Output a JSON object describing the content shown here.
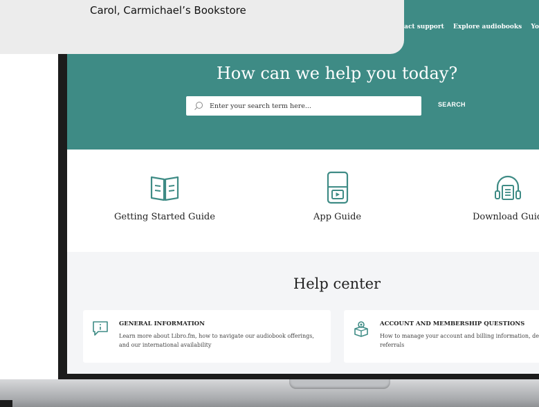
{
  "caption": {
    "text": "Carol, Carmichael’s Bookstore"
  },
  "nav": {
    "items": [
      "ntact support",
      "Explore audiobooks",
      "Yo"
    ]
  },
  "hero": {
    "title": "How can we help you today?",
    "search_placeholder": "Enter your search term here...",
    "search_button": "SEARCH"
  },
  "guides": [
    {
      "label": "Getting Started Guide",
      "icon": "open-book-icon"
    },
    {
      "label": "App Guide",
      "icon": "phone-play-icon"
    },
    {
      "label": "Download Guid",
      "icon": "headphones-book-icon"
    }
  ],
  "help_center": {
    "title": "Help center",
    "cards": [
      {
        "title": "GENERAL INFORMATION",
        "description": "Learn more about Libro.fm, how to navigate our audiobook offerings, and our international availability",
        "icon": "info-chat-icon"
      },
      {
        "title": "ACCOUNT AND MEMBERSHIP QUESTIONS",
        "description": "How to manage your account and billing information, details, and referrals",
        "icon": "account-box-icon"
      }
    ]
  },
  "colors": {
    "teal": "#3e8b85",
    "icon_teal": "#3e8b85",
    "bezel": "#1c1c1c"
  }
}
